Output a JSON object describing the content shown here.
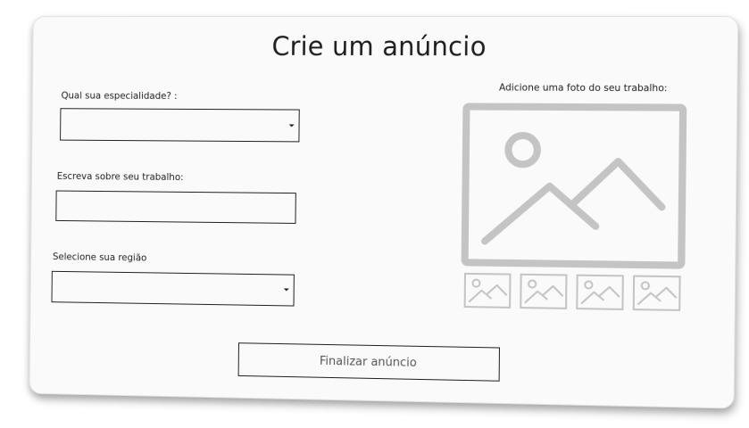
{
  "page": {
    "title": "Crie um anúncio"
  },
  "form": {
    "specialty_label": "Qual sua especialidade? :",
    "specialty_value": "",
    "about_label": "Escreva sobre seu trabalho:",
    "about_value": "",
    "region_label": "Selecione sua região",
    "region_value": ""
  },
  "photos": {
    "label": "Adicione uma foto do seu trabalho:",
    "main_icon": "image-placeholder-icon",
    "thumbnail_icon": "image-placeholder-icon",
    "thumbnail_count": 4
  },
  "actions": {
    "finish_label": "Finalizar anúncio"
  },
  "colors": {
    "placeholder_gray": "#c4c4c4",
    "border": "#1e1e1e",
    "card_background": "#fafafa"
  }
}
